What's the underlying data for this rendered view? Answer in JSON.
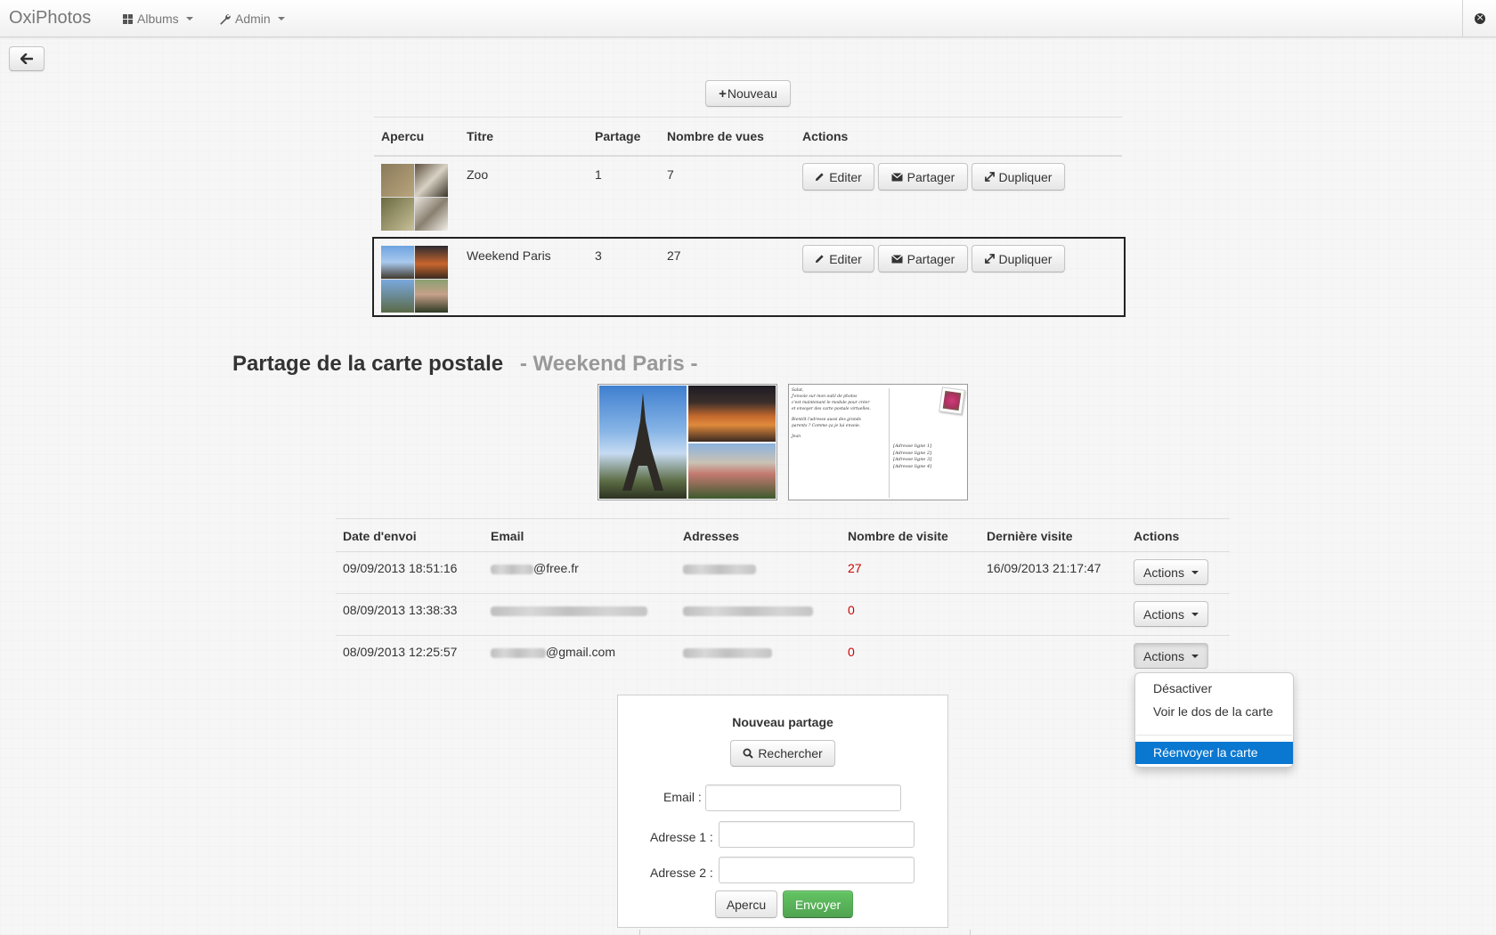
{
  "navbar": {
    "brand": "OxiPhotos",
    "albums_label": "Albums",
    "admin_label": "Admin"
  },
  "toolbar": {
    "new_label": "Nouveau"
  },
  "albums_table": {
    "headers": [
      "Apercu",
      "Titre",
      "Partage",
      "Nombre de vues",
      "Actions"
    ],
    "rows": [
      {
        "title": "Zoo",
        "shares": "1",
        "views": "7"
      },
      {
        "title": "Weekend Paris",
        "shares": "3",
        "views": "27"
      }
    ],
    "edit_label": "Editer",
    "share_label": "Partager",
    "duplicate_label": "Dupliquer"
  },
  "share_section": {
    "title": "Partage de la carte postale",
    "album_name": "- Weekend Paris -",
    "postcard_back_lines": [
      "Salut,",
      "J'envoie sur mon outil de photos",
      "c'est maintenant le module pour créer",
      "et envoyer des carte postale virtuelles.",
      "",
      "Bientôt l'adresse aussi des grands",
      "parents ? Comme ça je lui envoie.",
      "",
      "Jean"
    ],
    "postcard_address_lines": [
      "[Adresse ligne 1]",
      "[Adresse ligne 2]",
      "[Adresse ligne 3]",
      "[Adresse ligne 4]"
    ]
  },
  "shares_table": {
    "headers": [
      "Date d'envoi",
      "Email",
      "Adresses",
      "Nombre de visite",
      "Dernière visite",
      "Actions"
    ],
    "rows": [
      {
        "date": "09/09/2013 18:51:16",
        "email_suffix": "@free.fr",
        "visits": "27",
        "last_visit": "16/09/2013 21:17:47"
      },
      {
        "date": "08/09/2013 13:38:33",
        "email_suffix": "",
        "visits": "0",
        "last_visit": ""
      },
      {
        "date": "08/09/2013 12:25:57",
        "email_suffix": "@gmail.com",
        "visits": "0",
        "last_visit": ""
      }
    ],
    "actions_label": "Actions"
  },
  "actions_menu": {
    "items": [
      "Désactiver",
      "Voir le dos de la carte",
      "Réenvoyer la carte"
    ],
    "active_index": 2
  },
  "new_share_form": {
    "title": "Nouveau partage",
    "search_label": "Rechercher",
    "email_label": "Email :",
    "address1_label": "Adresse 1 :",
    "address2_label": "Adresse 2 :",
    "preview_label": "Apercu",
    "send_label": "Envoyer"
  },
  "colors": {
    "accent_blue": "#0a77d0",
    "danger_red": "#cc0000",
    "success_green": "#5bb75b",
    "muted_grey": "#999999"
  }
}
